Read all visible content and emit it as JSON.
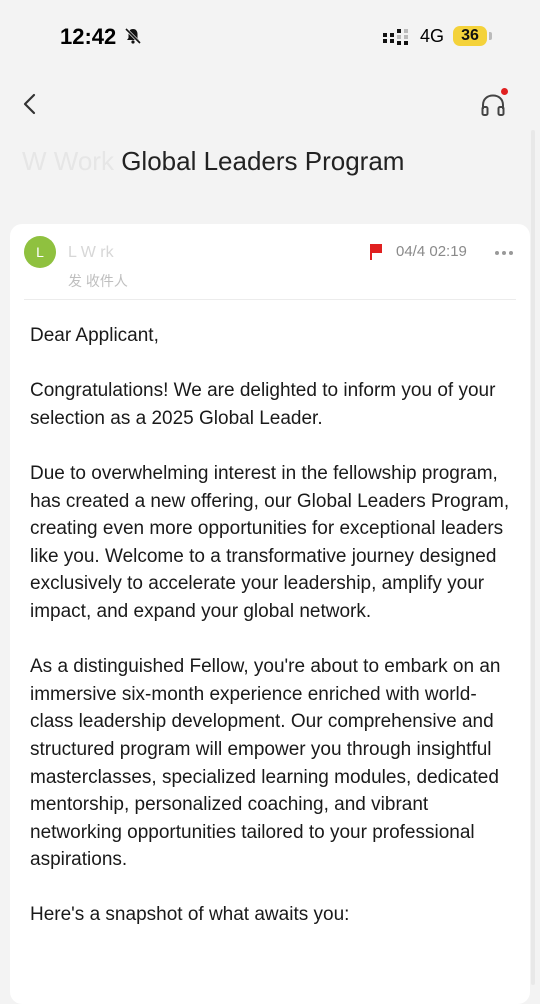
{
  "status_bar": {
    "time": "12:42",
    "network": "4G",
    "battery": "36"
  },
  "header": {
    "subject_hidden": "W           Work ",
    "subject_visible": "Global Leaders Program"
  },
  "mail": {
    "avatar_letter": "L",
    "sender": "L                    W       rk",
    "recipient": "发                     收件人",
    "date": "04/4 02:19"
  },
  "body": {
    "greeting": "Dear Applicant,",
    "p1": "Congratulations! We are delighted to inform you of your selection as a 2025        Global Leader.",
    "p2": "Due to overwhelming interest in the fellowship program,           has created a new offering, our Global Leaders Program, creating even more opportunities for exceptional leaders like you. Welcome to a transformative journey designed exclusively to accelerate your leadership, amplify your impact, and expand your global network.",
    "p3": "As a distinguished              Fellow, you're about to embark on an immersive six-month experience enriched with world-class leadership development. Our comprehensive and structured program will empower you through insightful masterclasses, specialized learning modules, dedicated mentorship, personalized coaching, and vibrant networking opportunities tailored to your professional aspirations.",
    "p4": "Here's a snapshot of what awaits you:"
  },
  "colors": {
    "avatar": "#8fc13f",
    "flag": "#e02020",
    "battery": "#f4d23a"
  }
}
